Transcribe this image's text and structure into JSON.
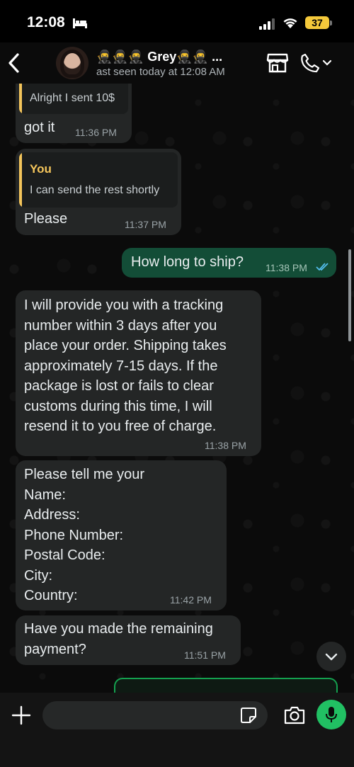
{
  "status_bar": {
    "time": "12:08",
    "battery": "37"
  },
  "header": {
    "contact_name": "🥷🥷🥷 Grey🥷🥷 ...",
    "last_seen": "ast seen today at 12:08 AM"
  },
  "messages": [
    {
      "direction": "in",
      "text": "got it",
      "time": "11:36 PM",
      "quote": {
        "author": "",
        "text": "Alright I sent 10$"
      }
    },
    {
      "direction": "in",
      "text": "Please",
      "time": "11:37 PM",
      "quote": {
        "author": "You",
        "text": "I can send the rest shortly"
      }
    },
    {
      "direction": "out",
      "text": "How long to ship?",
      "time": "11:38 PM",
      "status": "read"
    },
    {
      "direction": "in",
      "text": "I will provide you with a tracking\nnumber within 3 days after you\nplace your order. Shipping  takes\napproximately 7-15 days. If the\npackage is lost or fails to clear\ncustoms during this time, I will\nresend it to you free of charge.",
      "time": "11:38 PM"
    },
    {
      "direction": "in",
      "text": "Please tell me your\nName:\nAddress:\nPhone Number:\nPostal Code:\nCity:\nCountry:",
      "time": "11:42 PM"
    },
    {
      "direction": "in",
      "text": "Have you made the remaining\npayment?",
      "time": "11:51 PM"
    }
  ],
  "input": {
    "value": "",
    "placeholder": ""
  },
  "colors": {
    "incoming": "#242626",
    "outgoing": "#134d37",
    "accent": "#21c063",
    "quote_author": "#f4c55b",
    "read_tick": "#53bdeb"
  }
}
